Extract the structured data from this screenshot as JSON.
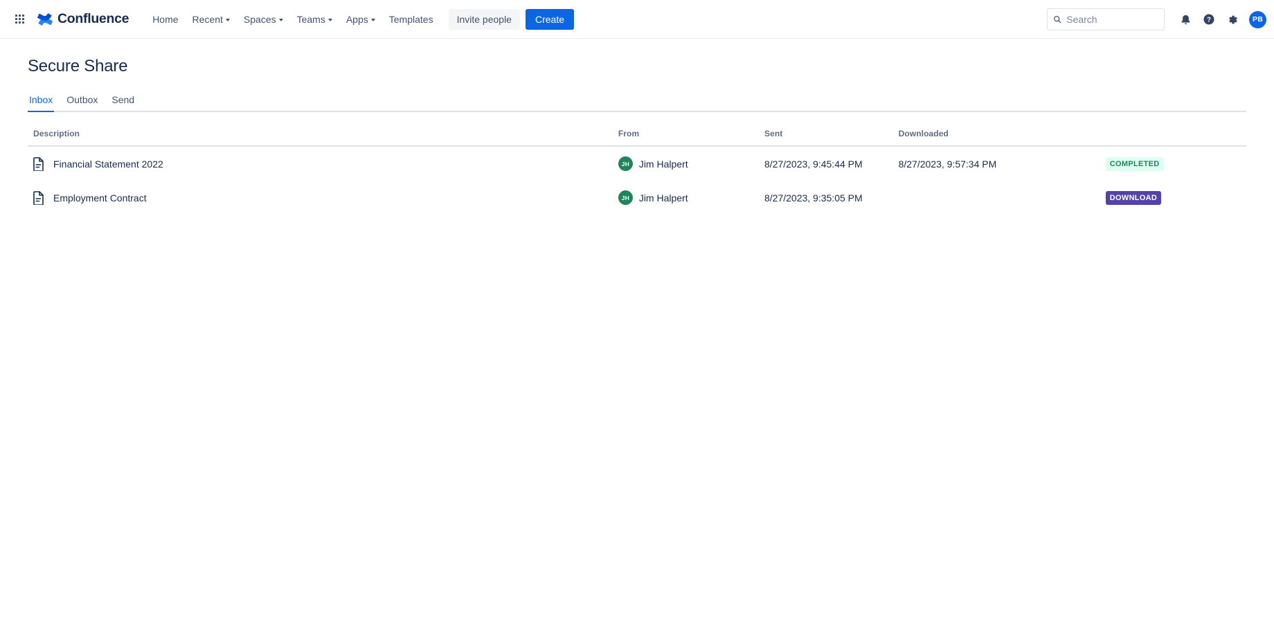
{
  "navbar": {
    "app_switcher_label": "app-switcher",
    "brand": "Confluence",
    "items": [
      {
        "label": "Home",
        "has_caret": false
      },
      {
        "label": "Recent",
        "has_caret": true
      },
      {
        "label": "Spaces",
        "has_caret": true
      },
      {
        "label": "Teams",
        "has_caret": true
      },
      {
        "label": "Apps",
        "has_caret": true
      },
      {
        "label": "Templates",
        "has_caret": false
      }
    ],
    "invite_label": "Invite people",
    "create_label": "Create",
    "search_placeholder": "Search",
    "search_value": "",
    "icons": [
      "notification-bell-icon",
      "help-icon",
      "settings-gear-icon"
    ],
    "profile_initials": "PB",
    "profile_color": "#0c66e4"
  },
  "page": {
    "title": "Secure Share",
    "tabs": [
      {
        "label": "Inbox",
        "active": true
      },
      {
        "label": "Outbox",
        "active": false
      },
      {
        "label": "Send",
        "active": false
      }
    ]
  },
  "table": {
    "columns": [
      "Description",
      "From",
      "Sent",
      "Downloaded",
      ""
    ],
    "rows": [
      {
        "description": "Financial Statement 2022",
        "from_initials": "JH",
        "from_name": "Jim Halpert",
        "sent": "8/27/2023, 9:45:44 PM",
        "downloaded": "8/27/2023, 9:57:34 PM",
        "status": "COMPLETED",
        "status_type": "completed"
      },
      {
        "description": "Employment Contract",
        "from_initials": "JH",
        "from_name": "Jim Halpert",
        "sent": "8/27/2023, 9:35:05 PM",
        "downloaded": "",
        "status": "DOWNLOAD",
        "status_type": "download"
      }
    ]
  },
  "colors": {
    "brand_blue": "#0c66e4",
    "avatar_green": "#1f845a",
    "badge_completed_bg": "#dcfff1",
    "badge_completed_text": "#1f845a",
    "badge_download_bg": "#5243aa",
    "badge_download_text": "#ffffff",
    "text_primary": "#172b4d",
    "text_muted": "#5e6c84"
  }
}
